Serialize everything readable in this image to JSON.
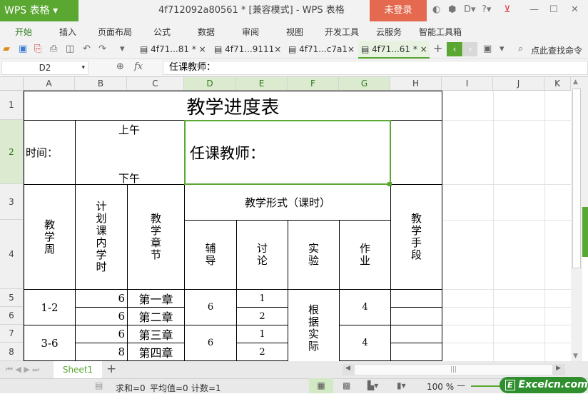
{
  "app": {
    "logo": "WPS 表格",
    "title": "4f712092a80561 * [兼容模式] - WPS 表格",
    "login": "未登录"
  },
  "menu": [
    "开始",
    "插入",
    "页面布局",
    "公式",
    "数据",
    "审阅",
    "视图",
    "开发工具",
    "云服务",
    "智能工具箱"
  ],
  "doc_tabs": [
    "4f71...81 *",
    "4f71...9111",
    "4f71...c7a1",
    "4f71...61 *"
  ],
  "search_label": "点此查找命令",
  "formula_bar": {
    "name_box": "D2",
    "fx": "fx",
    "value": "任课教师："
  },
  "columns": [
    "A",
    "B",
    "C",
    "D",
    "E",
    "F",
    "G",
    "H",
    "I",
    "J",
    "K"
  ],
  "rows": [
    "1",
    "2",
    "3",
    "4",
    "5",
    "6",
    "7",
    "8"
  ],
  "cells": {
    "title": "教学进度表",
    "time": "时间：",
    "am": "上午",
    "pm": "下午",
    "teacher": "任课教师：",
    "week": "教学周",
    "hours": "计划课内学时",
    "chapter": "教学章节",
    "form": "教学形式（课时）",
    "tutor": "辅导",
    "discuss": "讨论",
    "lab": "实验",
    "homework": "作业",
    "means": "教学手段",
    "w1": "1-2",
    "w2": "3-6",
    "b5": "6",
    "b6": "6",
    "b7": "6",
    "b8": "8",
    "c5": "第一章",
    "c6": "第二章",
    "c7": "第三章",
    "c8": "第四章",
    "d56": "6",
    "d78": "6",
    "e5": "1",
    "e6": "2",
    "e7": "1",
    "e8": "2",
    "f58": "根据实际",
    "g56": "4",
    "g78": "4"
  },
  "sheet_tab": "Sheet1",
  "status": {
    "sum": "求和=0",
    "avg": "平均值=0",
    "count": "计数=1",
    "zoom": "100 %"
  },
  "watermark": "Excelcn.com"
}
